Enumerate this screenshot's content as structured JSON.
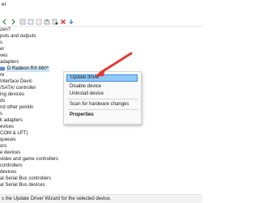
{
  "window": {
    "title": "er"
  },
  "menu": {
    "first_item": ""
  },
  "toolbar": {
    "icons": [
      "back-icon",
      "forward-icon",
      "properties-icon",
      "help-icon",
      "scan-icon",
      "update-driver-icon",
      "disable-icon",
      "uninstall-icon",
      "download-icon"
    ]
  },
  "tree": {
    "rows": [
      {
        "label": "zen?",
        "icon": "computer-icon"
      },
      {
        "label": "puts and outputs",
        "icon": "audio-icon"
      },
      {
        "label": "s",
        "icon": "battery-icon"
      },
      {
        "label": "er",
        "icon": "computer-icon"
      },
      {
        "label": "ves",
        "icon": "disk-icon"
      },
      {
        "label": "adapters",
        "icon": "display-icon"
      },
      {
        "label": "D Radeon RX 660*",
        "icon": "display-adapter-icon",
        "selected": true
      },
      {
        "label": "re",
        "icon": "firmware-icon"
      },
      {
        "label": "Interface Devic",
        "icon": "hid-icon"
      },
      {
        "label": "/SATA/ controller",
        "icon": "ide-icon"
      },
      {
        "label": "ing devices",
        "icon": "imaging-icon"
      },
      {
        "label": "ds",
        "icon": "keyboard-icon"
      },
      {
        "label": "nd other pointin",
        "icon": "mouse-icon"
      },
      {
        "label": "s",
        "icon": "monitor-icon"
      },
      {
        "label": "k adapters",
        "icon": "network-icon"
      },
      {
        "label": "evices",
        "icon": "device-icon"
      },
      {
        "label": "COM & LPT)",
        "icon": "port-icon"
      },
      {
        "label": "queues",
        "icon": "print-queue-icon"
      },
      {
        "label": "ors",
        "icon": "processor-icon"
      },
      {
        "label": "e devices",
        "icon": "software-icon"
      },
      {
        "label": "video and game controllers",
        "icon": "sound-icon"
      },
      {
        "label": "controllers",
        "icon": "storage-icon"
      },
      {
        "label": "devices",
        "icon": "system-icon"
      },
      {
        "label": "al Serial Bus controllers",
        "icon": "usb-icon"
      },
      {
        "label": "al Serial Bus devices",
        "icon": "usb-icon"
      }
    ]
  },
  "context_menu": {
    "items": [
      {
        "label": "Update driver",
        "highlighted": true
      },
      {
        "label": "Disable device"
      },
      {
        "label": "Uninstall device"
      },
      {
        "label": "Scan for hardware changes"
      },
      {
        "label": "Properties",
        "bold": true
      }
    ]
  },
  "status": {
    "text": "s the Update Driver Wizard for the selected device."
  },
  "colors": {
    "arrow": "#e53935",
    "highlight": "#91c9f7",
    "selection": "#cce4f7"
  }
}
